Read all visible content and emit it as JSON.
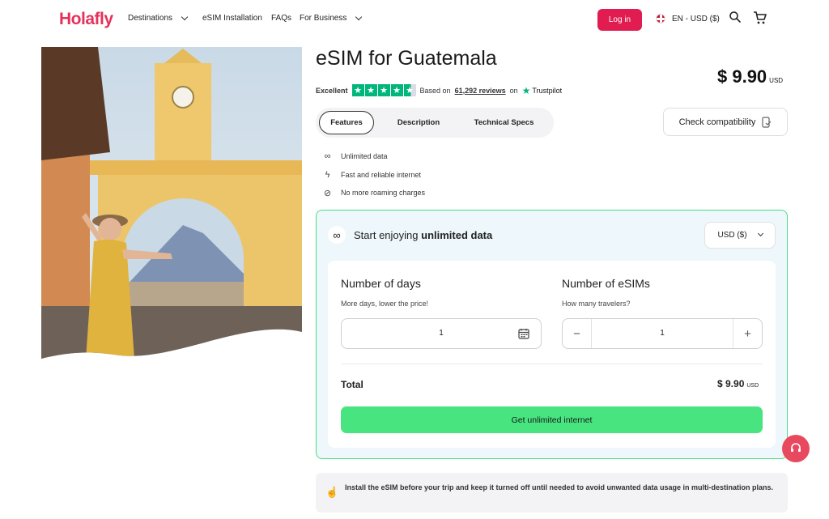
{
  "header": {
    "logo": "Holafly",
    "nav": {
      "destinations": "Destinations",
      "esim_installation": "eSIM Installation",
      "faqs": "FAQs",
      "for_business": "For Business"
    },
    "login_label": "Log in",
    "language_currency": "EN - USD ($)",
    "icons": [
      "search-icon",
      "cart-icon",
      "chevron-down-icon"
    ]
  },
  "product": {
    "title": "eSIM for Guatemala",
    "price": "$ 9.90",
    "price_currency": "USD",
    "rating": {
      "label": "Excellent",
      "stars": 4.5,
      "based_on": "Based on",
      "reviews": "61,292 reviews",
      "on": "on",
      "provider": "Trustpilot"
    },
    "tabs": [
      "Features",
      "Description",
      "Technical Specs"
    ],
    "active_tab": "Features",
    "check_compatibility": "Check compatibility",
    "features": [
      {
        "icon": "infinity-icon",
        "text": "Unlimited data"
      },
      {
        "icon": "lightning-icon",
        "text": "Fast and reliable internet"
      },
      {
        "icon": "no-roaming-icon",
        "text": "No more roaming charges"
      }
    ]
  },
  "purchase": {
    "title_prefix": "Start enjoying",
    "title_bold": "unlimited data",
    "currency_select": "USD ($)",
    "days": {
      "label": "Number of days",
      "sub": "More days, lower the price!",
      "value": "1"
    },
    "esims": {
      "label": "Number of eSIMs",
      "sub": "How many travelers?",
      "value": "1",
      "minus": "−",
      "plus": "+"
    },
    "total_label": "Total",
    "total_value": "$ 9.90",
    "total_currency": "USD",
    "cta": "Get unlimited internet"
  },
  "tip": {
    "text": "Install the eSIM before your trip and keep it turned off until needed to avoid unwanted data usage in multi-destination plans."
  },
  "colors": {
    "brand": "#e01c50",
    "cta_green": "#47e47f",
    "trustpilot": "#00b67a",
    "card_border": "#4ade80"
  }
}
